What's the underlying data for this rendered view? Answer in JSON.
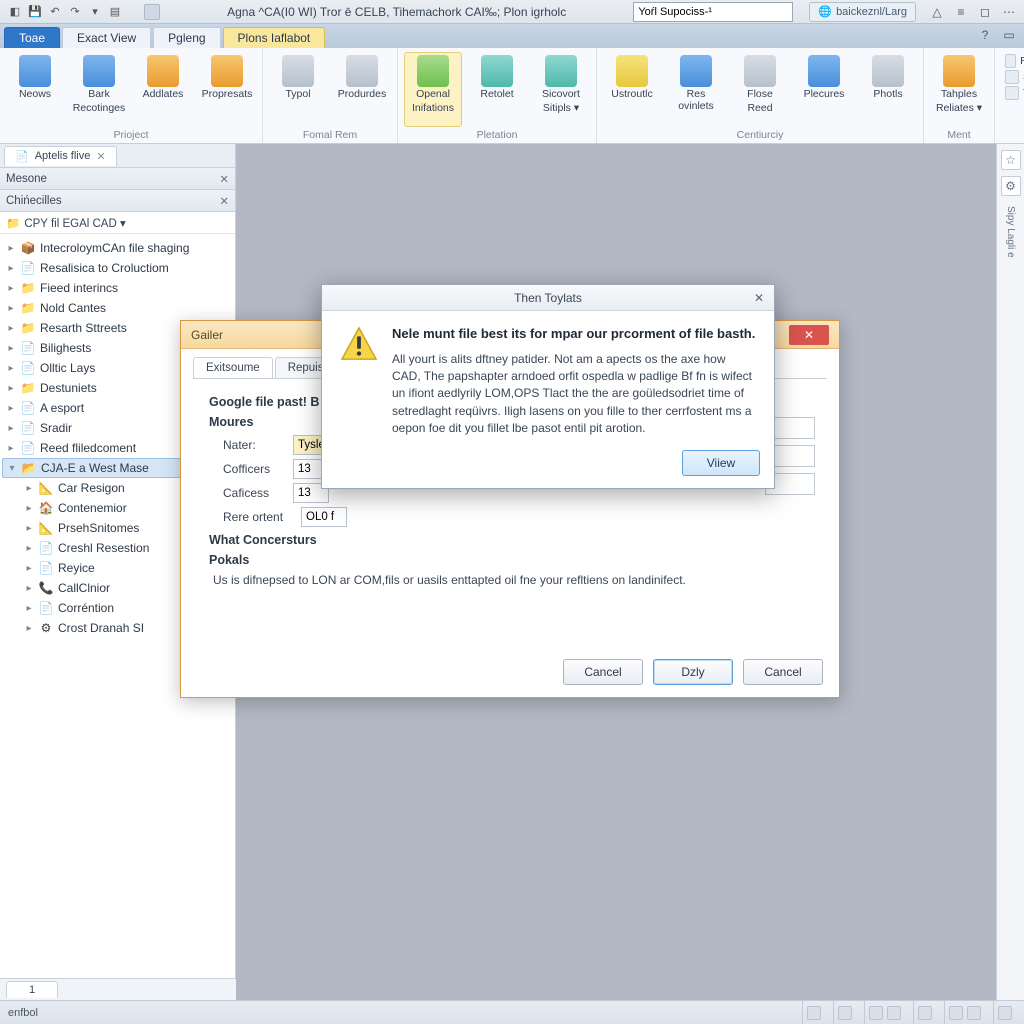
{
  "titlebar": {
    "caption": "Agna  ^CA(I0  WI)  Tror ē CELB, Tihemachork CAI‰; Plon igrholc",
    "search_value": "Yoŕl Supociss-¹",
    "pill": "baickeznl/Larg"
  },
  "ribbon_tabs": [
    "Toae",
    "Exact View",
    "Pgleng",
    "Plons Iaflabot"
  ],
  "ribbon": {
    "groups": [
      {
        "label": "Prioject",
        "items": [
          {
            "label": "Neows",
            "sub": "",
            "icon": "i-blue"
          },
          {
            "label": "Bark",
            "sub": "Recotinges",
            "icon": "i-blue"
          },
          {
            "label": "Addlates",
            "sub": "",
            "icon": "i-orange"
          },
          {
            "label": "Propresats",
            "sub": "",
            "icon": "i-orange"
          }
        ]
      },
      {
        "label": "Fomal Rem",
        "items": [
          {
            "label": "Typol",
            "sub": "",
            "icon": "i-gray"
          },
          {
            "label": "Produrdes",
            "sub": "",
            "icon": "i-gray"
          }
        ]
      },
      {
        "label": "Pletation",
        "items": [
          {
            "label": "Openal",
            "sub": "Inifations",
            "icon": "i-green",
            "active": true
          },
          {
            "label": "Retolet",
            "sub": "",
            "icon": "i-teal"
          },
          {
            "label": "Sicovort",
            "sub": "Sitipls ▾",
            "icon": "i-teal"
          }
        ]
      },
      {
        "label": "Centiurciy",
        "items": [
          {
            "label": "Ustroutlc",
            "sub": "",
            "icon": "i-yellow"
          },
          {
            "label": "Res ovinlets",
            "sub": "",
            "icon": "i-blue"
          },
          {
            "label": "Flose",
            "sub": "Reed",
            "icon": "i-gray"
          },
          {
            "label": "Plecures",
            "sub": "",
            "icon": "i-blue"
          },
          {
            "label": "Photls",
            "sub": "",
            "icon": "i-gray"
          }
        ]
      },
      {
        "label": "Ment",
        "items": [
          {
            "label": "Tahples",
            "sub": "Reliates ▾",
            "icon": "i-orange"
          }
        ]
      }
    ],
    "mini": [
      "Riald",
      "Set",
      "To"
    ]
  },
  "doc_tab": "Aptelis flive",
  "project_panel_label": "Mesone",
  "tree_panel_label": "Chińecilles",
  "project_selector": "CPY fil EGAl CAD ▾",
  "tree": [
    {
      "label": "IntecroloymCAn file shaging",
      "ic": "📦"
    },
    {
      "label": "Resalisica to Croluctiom",
      "ic": "📄"
    },
    {
      "label": "Fieed interincs",
      "ic": "📁"
    },
    {
      "label": "Nold Cantes",
      "ic": "📁"
    },
    {
      "label": "Resarth Sttreets",
      "ic": "📁"
    },
    {
      "label": "Bilighests",
      "ic": "📄"
    },
    {
      "label": "Olltic Lays",
      "ic": "📄"
    },
    {
      "label": "Destuniets",
      "ic": "📁"
    },
    {
      "label": "A esport",
      "ic": "📄"
    },
    {
      "label": "Sradir",
      "ic": "📄"
    },
    {
      "label": "Reed fliledcoment",
      "ic": "📄"
    },
    {
      "label": "CJA-E a West Mase",
      "ic": "📂",
      "sel": true,
      "children": [
        {
          "label": "Car Resigon",
          "ic": "📐"
        },
        {
          "label": "Contenemior",
          "ic": "🏠"
        },
        {
          "label": "PrsehSnitomes",
          "ic": "📐"
        },
        {
          "label": "Creshl Resestion",
          "ic": "📄"
        },
        {
          "label": "Reyice",
          "ic": "📄"
        },
        {
          "label": "CallClnior",
          "ic": "📞"
        },
        {
          "label": "Corréntion",
          "ic": "📄"
        },
        {
          "label": "Crost Dranah SI",
          "ic": "⚙"
        }
      ]
    }
  ],
  "sheet": "1",
  "status_left": "enfbol",
  "dialog_back": {
    "title": "Gailer",
    "tabs": [
      "Exitsoume",
      "Repuised H"
    ],
    "h_google": "Google file past! B",
    "h_moures": "Moures",
    "row_nater_label": "Nater:",
    "row_nater_value": "Tysle",
    "row_cofficers_label": "Cofficers",
    "row_cofficers_value": "13",
    "row_caficess_label": "Caficess",
    "row_caficess_value": "13",
    "row_rere_label": "Rere ortent",
    "row_rere_value": "OL0 f",
    "h_what": "What Concersturs",
    "h_pokals": "Pokals",
    "para": "Us is difnepsed to LON ar COM,fils or uasils enttapted oil fne your refltiens on landinifect.",
    "btn_cancel_l": "Cancel",
    "btn_primary": "Dzly",
    "btn_cancel_r": "Cancel"
  },
  "dialog_front": {
    "title": "Then Toylats",
    "heading": "Nele munt file best its for mpar our prcorment of file basth.",
    "body": "All yourt is alits dftney patider. Not am a apects os the axe how CAD, The papshapter arndoed orfit ospedla w padlige Bf fn is wifect un ifiont aedlyrily LOM,OPS Tlact the the are goüledsodriet time of setredlaght reqüivrs. Iligh lasens on you fille to ther cerrfostent ms a oepon foe dit you fillet lbe pasot entil pit arotion.",
    "btn": "Viiew"
  },
  "right_strip": "Sipy Lagli e"
}
